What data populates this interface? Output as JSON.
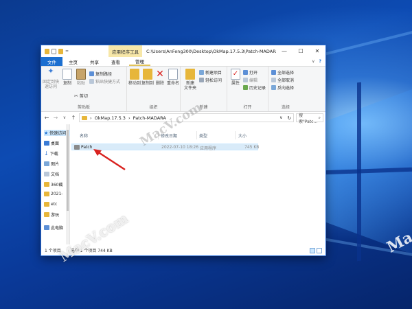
{
  "title_bar": {
    "context_tab": "应用程序工具",
    "path": "C:\\Users\\AnFeng300\\Desktop\\OkMap.17.5.3\\Patch-MADARA",
    "minimize": "—",
    "maximize": "☐",
    "close": "✕"
  },
  "ribbon_tabs": [
    "文件",
    "主页",
    "共享",
    "查看",
    "管理"
  ],
  "ribbon_right": {
    "collapse": "∨",
    "help": "?"
  },
  "ribbon": {
    "clipboard": {
      "pin": "固定到快\n速访问",
      "copy": "复制",
      "paste": "粘贴",
      "copy_path": "复制路径",
      "paste_shortcut": "粘贴快捷方式",
      "cut": "剪切",
      "label": "剪贴板"
    },
    "organize": {
      "move_to": "移动到",
      "copy_to": "复制到",
      "delete": "删除",
      "rename": "重命名",
      "label": "组织"
    },
    "new": {
      "new_item": "新建项目",
      "easy_access": "轻松访问",
      "new_folder": "新建\n文件夹",
      "label": "新建"
    },
    "open": {
      "properties": "属性",
      "open": "打开",
      "edit": "编辑",
      "history": "历史记录",
      "label": "打开"
    },
    "select": {
      "select_all": "全部选择",
      "select_none": "全部取消",
      "invert": "反向选择",
      "label": "选择"
    }
  },
  "address": {
    "back": "←",
    "forward": "→",
    "up": "↑",
    "crumbs": [
      "OkMap.17.5.3",
      "Patch-MADARA"
    ],
    "refresh": "↻",
    "search_placeholder": "搜索\"Patc...",
    "search_icon": "search-icon"
  },
  "nav": {
    "items": [
      "快速访问",
      "桌面",
      "下载",
      "图片",
      "文档",
      "360截",
      "2021-",
      "etc",
      "游玩",
      "此电脑"
    ]
  },
  "columns": {
    "name": "名称",
    "date": "修改日期",
    "type": "类型",
    "size": "大小"
  },
  "files": [
    {
      "name": "Patch",
      "date": "2022-07-10 18:26",
      "type": "应用程序",
      "size": "745 KB"
    }
  ],
  "status": {
    "count": "1 个项目",
    "selected": "选中 1 个项目 744 KB"
  },
  "watermarks": {
    "inside_1": "MacV.com",
    "inside_2": "MacV.com",
    "desktop": "Ma"
  },
  "colors": {
    "accent": "#1c6fd0",
    "selection": "#d9ebf9",
    "context_tab": "#f7e7a8",
    "arrow": "#d9221f"
  }
}
